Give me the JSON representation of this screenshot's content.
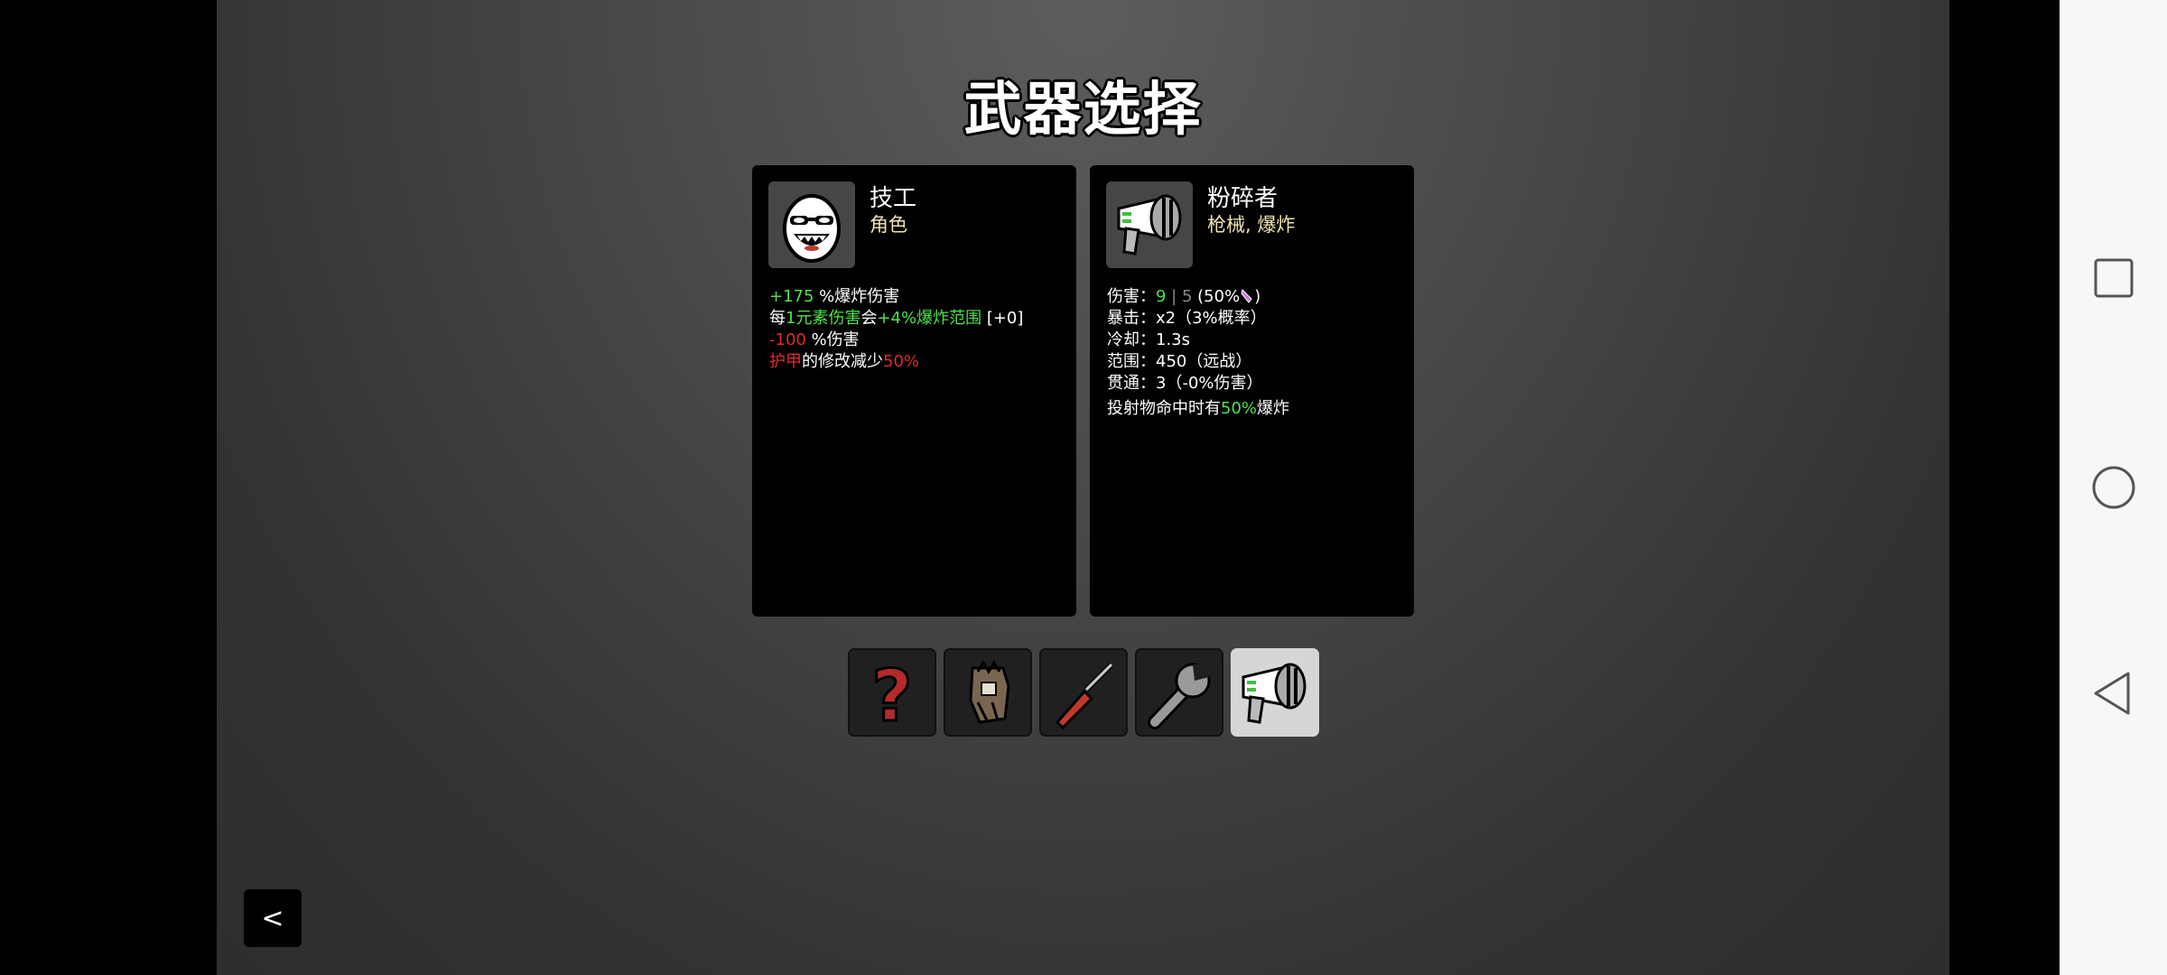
{
  "title": "武器选择",
  "character_card": {
    "name": "技工",
    "subtitle": "角色",
    "icon": "egg-character-icon",
    "stats": {
      "l1": {
        "a": "+175",
        "b": " %爆炸伤害"
      },
      "l2": {
        "a": "每",
        "b": "1元素伤害",
        "c": "会",
        "d": "+4%爆炸范围",
        "e": " [+0]"
      },
      "l3": {
        "a": "-100",
        "b": " %伤害"
      },
      "l4": {
        "a": "护甲",
        "b": "的修改减少",
        "c": "50%"
      }
    }
  },
  "weapon_card": {
    "name": "粉碎者",
    "subtitle": "枪械, 爆炸",
    "icon": "blaster-gun-icon",
    "stats": {
      "damage": {
        "label": "伤害：",
        "value": "9",
        "sep": " | ",
        "base": "5",
        "suffix": " (50%",
        "close": ")"
      },
      "crit": {
        "label": "暴击：",
        "value": "x2（3%概率）"
      },
      "cooldown": {
        "label": "冷却：",
        "value": "1.3s"
      },
      "range": {
        "label": "范围：",
        "value": "450（远战）"
      },
      "pierce": {
        "label": "贯通：",
        "value": "3（-0%伤害）"
      },
      "special": {
        "a": "投射物命中时有",
        "b": "50%",
        "c": "爆炸"
      }
    }
  },
  "weapon_slots": [
    {
      "icon": "question-mark-icon",
      "selected": false
    },
    {
      "icon": "hand-icon",
      "selected": false
    },
    {
      "icon": "screwdriver-icon",
      "selected": false
    },
    {
      "icon": "wrench-icon",
      "selected": false
    },
    {
      "icon": "blaster-gun-icon",
      "selected": true
    }
  ],
  "back_button": {
    "label": "<"
  },
  "nav": {
    "recents": "square-icon",
    "home": "circle-icon",
    "back": "triangle-back-icon"
  },
  "colors": {
    "positive": "#4de34a",
    "negative": "#e02a2a",
    "subtitle": "#efe3b0",
    "selected_slot": "#d6d6d6"
  }
}
